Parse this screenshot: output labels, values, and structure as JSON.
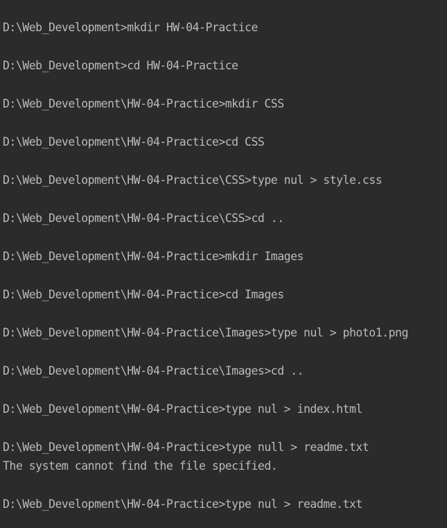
{
  "terminal": {
    "lines": [
      "D:\\Web_Development>mkdir HW-04-Practice",
      "D:\\Web_Development>cd HW-04-Practice",
      "D:\\Web_Development\\HW-04-Practice>mkdir CSS",
      "D:\\Web_Development\\HW-04-Practice>cd CSS",
      "D:\\Web_Development\\HW-04-Practice\\CSS>type nul > style.css",
      "D:\\Web_Development\\HW-04-Practice\\CSS>cd ..",
      "D:\\Web_Development\\HW-04-Practice>mkdir Images",
      "D:\\Web_Development\\HW-04-Practice>cd Images",
      "D:\\Web_Development\\HW-04-Practice\\Images>type nul > photo1.png",
      "D:\\Web_Development\\HW-04-Practice\\Images>cd ..",
      "D:\\Web_Development\\HW-04-Practice>type nul > index.html",
      "D:\\Web_Development\\HW-04-Practice>type null > readme.txt",
      "The system cannot find the file specified.",
      "D:\\Web_Development\\HW-04-Practice>type nul > readme.txt"
    ]
  }
}
